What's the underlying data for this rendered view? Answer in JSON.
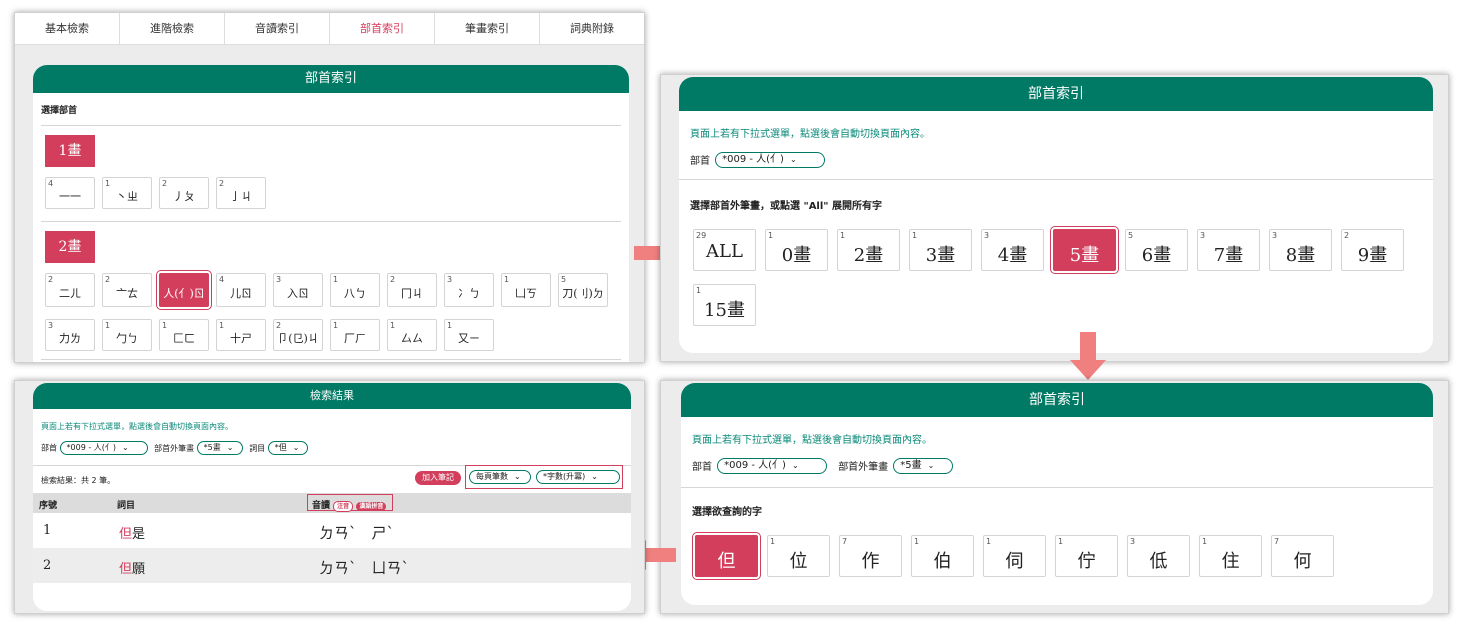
{
  "panel1": {
    "tabs": [
      "基本檢索",
      "進階檢索",
      "音讀索引",
      "部首索引",
      "筆畫索引",
      "詞典附錄"
    ],
    "active_tab": "部首索引",
    "header": "部首索引",
    "select_label": "選擇部首",
    "group1_label": "1畫",
    "group1": [
      {
        "n": "4",
        "t": "一一"
      },
      {
        "n": "1",
        "t": "丶ㄓ"
      },
      {
        "n": "2",
        "t": "丿ㄆ"
      },
      {
        "n": "2",
        "t": "亅ㄐ"
      }
    ],
    "group2_label": "2畫",
    "group2_row1": [
      {
        "n": "2",
        "t": "二ㄦ"
      },
      {
        "n": "2",
        "t": "亠ㄊ"
      },
      {
        "n": "",
        "t": "人(亻)ㄖ"
      },
      {
        "n": "4",
        "t": "儿ㄖ"
      },
      {
        "n": "3",
        "t": "入ㄖ"
      },
      {
        "n": "1",
        "t": "八ㄅ"
      },
      {
        "n": "2",
        "t": "冂ㄐ"
      },
      {
        "n": "3",
        "t": "冫ㄅ"
      },
      {
        "n": "1",
        "t": "凵ㄎ"
      },
      {
        "n": "5",
        "t": "刀(刂)ㄉ"
      }
    ],
    "group2_row2": [
      {
        "n": "3",
        "t": "力ㄌ"
      },
      {
        "n": "1",
        "t": "勹ㄅ"
      },
      {
        "n": "1",
        "t": "匚ㄈ"
      },
      {
        "n": "1",
        "t": "十ㄕ"
      },
      {
        "n": "2",
        "t": "卩(㔾)ㄐ"
      },
      {
        "n": "1",
        "t": "厂ㄏ"
      },
      {
        "n": "1",
        "t": "厶ㄙ"
      },
      {
        "n": "1",
        "t": "又ㄧ"
      }
    ]
  },
  "panel2": {
    "header": "部首索引",
    "note": "頁面上若有下拉式選單，點選後會自動切換頁面內容。",
    "radical_label": "部首",
    "radical_value": "*009 - 人(亻)",
    "prompt": "選擇部首外筆畫，或點選 \"All\" 展開所有字",
    "buttons": [
      {
        "n": "29",
        "t": "ALL"
      },
      {
        "n": "1",
        "t": "0畫"
      },
      {
        "n": "1",
        "t": "2畫"
      },
      {
        "n": "1",
        "t": "3畫"
      },
      {
        "n": "3",
        "t": "4畫"
      },
      {
        "n": "",
        "t": "5畫"
      },
      {
        "n": "5",
        "t": "6畫"
      },
      {
        "n": "3",
        "t": "7畫"
      },
      {
        "n": "3",
        "t": "8畫"
      },
      {
        "n": "2",
        "t": "9畫"
      }
    ],
    "button_extra": {
      "n": "1",
      "t": "15畫"
    }
  },
  "panel3": {
    "header": "部首索引",
    "note": "頁面上若有下拉式選單，點選後會自動切換頁面內容。",
    "radical_label": "部首",
    "radical_value": "*009 - 人(亻)",
    "strokes_label": "部首外筆畫",
    "strokes_value": "*5畫",
    "prompt": "選擇欲查詢的字",
    "chars": [
      {
        "n": "",
        "t": "但"
      },
      {
        "n": "1",
        "t": "位"
      },
      {
        "n": "7",
        "t": "作"
      },
      {
        "n": "1",
        "t": "伯"
      },
      {
        "n": "1",
        "t": "伺"
      },
      {
        "n": "1",
        "t": "佇"
      },
      {
        "n": "3",
        "t": "低"
      },
      {
        "n": "1",
        "t": "住"
      },
      {
        "n": "7",
        "t": "何"
      }
    ]
  },
  "panel4": {
    "header": "檢索結果",
    "note": "頁面上若有下拉式選單，點選後會自動切換頁面內容。",
    "radical_label": "部首",
    "radical_value": "*009 - 人(亻)",
    "strokes_label": "部首外筆畫",
    "strokes_value": "*5畫",
    "word_label": "詞目",
    "word_value": "*但",
    "result_text": "檢索結果：共 2 筆。",
    "add_note_button": "加入筆記",
    "per_page": "每頁筆數",
    "sort": "*字數(升冪)",
    "col_no": "序號",
    "col_word": "詞目",
    "col_reading": "音讀",
    "pill_zhuyin": "注音",
    "pill_pinyin": "漢語拼音",
    "rows": [
      {
        "no": "1",
        "head": "但",
        "rest": "是",
        "reading": "ㄉㄢˋ　ㄕˋ"
      },
      {
        "no": "2",
        "head": "但",
        "rest": "願",
        "reading": "ㄉㄢˋ　ㄩㄢˋ"
      }
    ]
  },
  "colors": {
    "brand": "#007a64",
    "accent": "#d23e5c",
    "arrow": "#f08080"
  }
}
